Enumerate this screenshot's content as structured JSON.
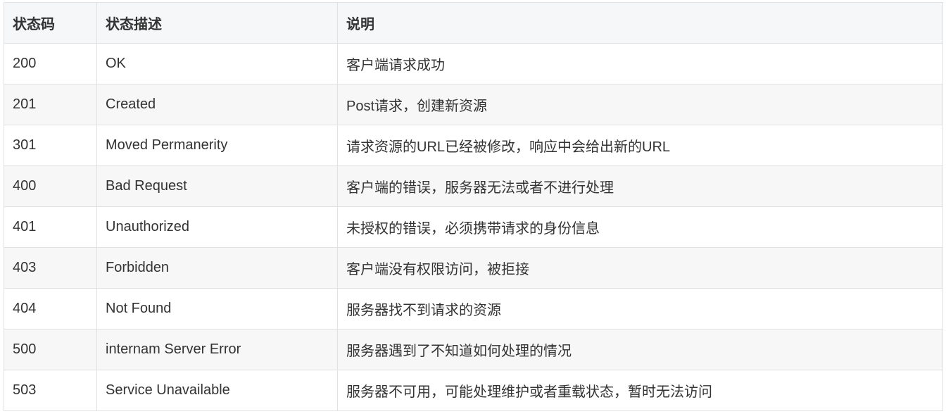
{
  "table": {
    "headers": [
      "状态码",
      "状态描述",
      "说明"
    ],
    "rows": [
      [
        "200",
        "OK",
        "客户端请求成功"
      ],
      [
        "201",
        "Created",
        "Post请求，创建新资源"
      ],
      [
        "301",
        "Moved Permanerity",
        "请求资源的URL已经被修改，响应中会给出新的URL"
      ],
      [
        "400",
        "Bad Request",
        "客户端的错误，服务器无法或者不进行处理"
      ],
      [
        "401",
        "Unauthorized",
        "未授权的错误，必须携带请求的身份信息"
      ],
      [
        "403",
        "Forbidden",
        "客户端没有权限访问，被拒接"
      ],
      [
        "404",
        "Not Found",
        "服务器找不到请求的资源"
      ],
      [
        "500",
        "internam Server Error",
        "服务器遇到了不知道如何处理的情况"
      ],
      [
        "503",
        "Service Unavailable",
        "服务器不可用，可能处理维护或者重载状态，暂时无法访问"
      ]
    ]
  }
}
